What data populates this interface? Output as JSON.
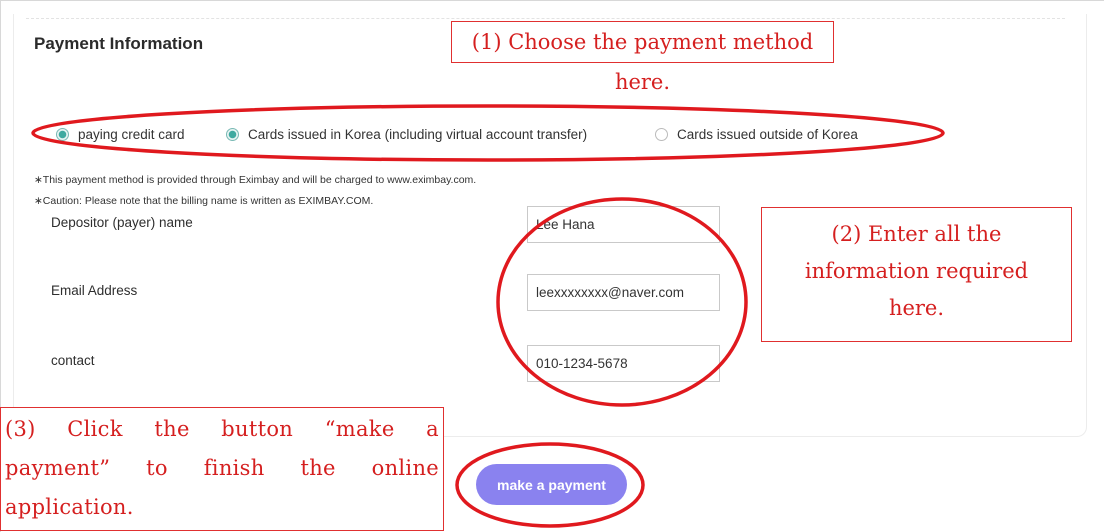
{
  "section": {
    "title": "Payment Information"
  },
  "payment_methods": [
    {
      "label": "paying credit card",
      "selected": true
    },
    {
      "label": "Cards issued in Korea (including virtual account transfer)",
      "selected": true
    },
    {
      "label": "Cards issued outside of Korea",
      "selected": false
    }
  ],
  "notes": [
    "∗This payment method is provided through Eximbay and will be charged to www.eximbay.com.",
    "∗Caution: Please note that the billing name is written as EXIMBAY.COM."
  ],
  "fields": {
    "depositor": {
      "label": "Depositor (payer) name",
      "value": "Lee Hana"
    },
    "email": {
      "label": "Email Address",
      "value": "leexxxxxxxx@naver.com"
    },
    "contact": {
      "label": "contact",
      "value": "010-1234-5678"
    }
  },
  "pay_button": {
    "label": "make a payment"
  },
  "callouts": {
    "step1": "(1) Choose the payment method here.",
    "step2_line1": "(2) Enter all the",
    "step2_line2": "information required",
    "step2_line3": "here.",
    "step3_line1": "(3) Click the button “make a",
    "step3_line2": "payment” to finish the online",
    "step3_line3": "application."
  },
  "colors": {
    "accent": "#8a82ef",
    "radio_selected": "#3fa9a0",
    "annotation_red": "#e0191e"
  }
}
